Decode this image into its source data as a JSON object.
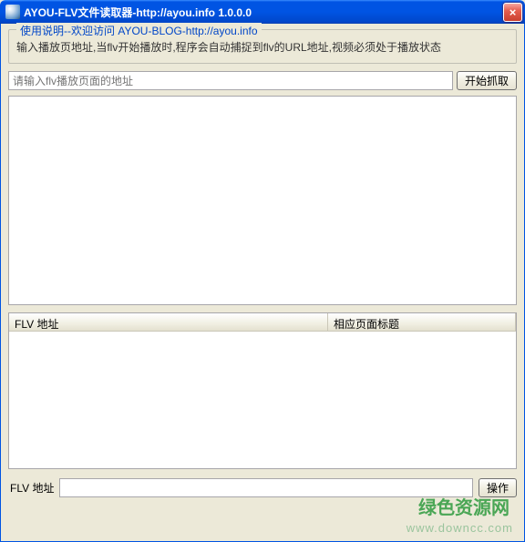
{
  "titlebar": {
    "title": "AYOU-FLV文件读取器-http://ayou.info 1.0.0.0",
    "close_glyph": "×"
  },
  "groupbox": {
    "title": "使用说明--欢迎访问 AYOU-BLOG-http://ayou.info",
    "instruction": "输入播放页地址,当flv开始播放时,程序会自动捕捉到flv的URL地址,视频必须处于播放状态"
  },
  "input": {
    "placeholder": "请输入flv播放页面的地址",
    "start_button": "开始抓取"
  },
  "listview": {
    "col1": "FLV 地址",
    "col2": "相应页面标题"
  },
  "bottom": {
    "label": "FLV 地址",
    "action_button": "操作"
  },
  "watermark": {
    "text": "绿色资源网",
    "sub": "www.downcc.com"
  }
}
